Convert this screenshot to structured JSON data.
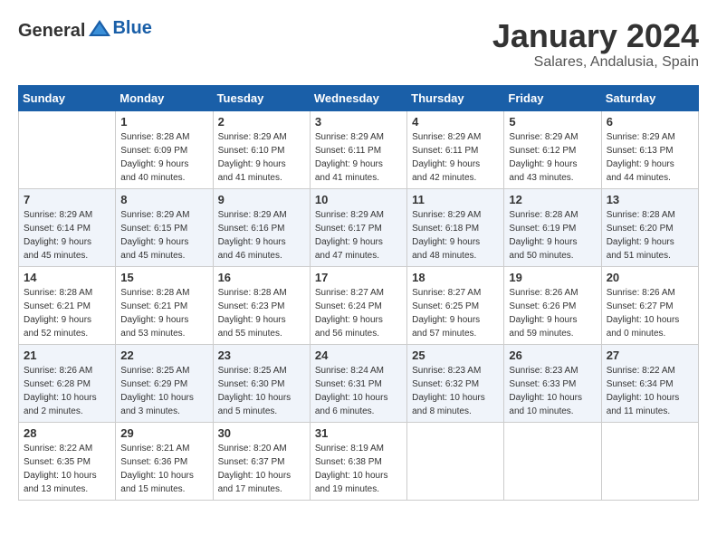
{
  "logo": {
    "general": "General",
    "blue": "Blue"
  },
  "header": {
    "month": "January 2024",
    "location": "Salares, Andalusia, Spain"
  },
  "columns": [
    "Sunday",
    "Monday",
    "Tuesday",
    "Wednesday",
    "Thursday",
    "Friday",
    "Saturday"
  ],
  "weeks": [
    [
      {
        "day": "",
        "info": ""
      },
      {
        "day": "1",
        "info": "Sunrise: 8:28 AM\nSunset: 6:09 PM\nDaylight: 9 hours\nand 40 minutes."
      },
      {
        "day": "2",
        "info": "Sunrise: 8:29 AM\nSunset: 6:10 PM\nDaylight: 9 hours\nand 41 minutes."
      },
      {
        "day": "3",
        "info": "Sunrise: 8:29 AM\nSunset: 6:11 PM\nDaylight: 9 hours\nand 41 minutes."
      },
      {
        "day": "4",
        "info": "Sunrise: 8:29 AM\nSunset: 6:11 PM\nDaylight: 9 hours\nand 42 minutes."
      },
      {
        "day": "5",
        "info": "Sunrise: 8:29 AM\nSunset: 6:12 PM\nDaylight: 9 hours\nand 43 minutes."
      },
      {
        "day": "6",
        "info": "Sunrise: 8:29 AM\nSunset: 6:13 PM\nDaylight: 9 hours\nand 44 minutes."
      }
    ],
    [
      {
        "day": "7",
        "info": "Sunrise: 8:29 AM\nSunset: 6:14 PM\nDaylight: 9 hours\nand 45 minutes."
      },
      {
        "day": "8",
        "info": "Sunrise: 8:29 AM\nSunset: 6:15 PM\nDaylight: 9 hours\nand 45 minutes."
      },
      {
        "day": "9",
        "info": "Sunrise: 8:29 AM\nSunset: 6:16 PM\nDaylight: 9 hours\nand 46 minutes."
      },
      {
        "day": "10",
        "info": "Sunrise: 8:29 AM\nSunset: 6:17 PM\nDaylight: 9 hours\nand 47 minutes."
      },
      {
        "day": "11",
        "info": "Sunrise: 8:29 AM\nSunset: 6:18 PM\nDaylight: 9 hours\nand 48 minutes."
      },
      {
        "day": "12",
        "info": "Sunrise: 8:28 AM\nSunset: 6:19 PM\nDaylight: 9 hours\nand 50 minutes."
      },
      {
        "day": "13",
        "info": "Sunrise: 8:28 AM\nSunset: 6:20 PM\nDaylight: 9 hours\nand 51 minutes."
      }
    ],
    [
      {
        "day": "14",
        "info": "Sunrise: 8:28 AM\nSunset: 6:21 PM\nDaylight: 9 hours\nand 52 minutes."
      },
      {
        "day": "15",
        "info": "Sunrise: 8:28 AM\nSunset: 6:21 PM\nDaylight: 9 hours\nand 53 minutes."
      },
      {
        "day": "16",
        "info": "Sunrise: 8:28 AM\nSunset: 6:23 PM\nDaylight: 9 hours\nand 55 minutes."
      },
      {
        "day": "17",
        "info": "Sunrise: 8:27 AM\nSunset: 6:24 PM\nDaylight: 9 hours\nand 56 minutes."
      },
      {
        "day": "18",
        "info": "Sunrise: 8:27 AM\nSunset: 6:25 PM\nDaylight: 9 hours\nand 57 minutes."
      },
      {
        "day": "19",
        "info": "Sunrise: 8:26 AM\nSunset: 6:26 PM\nDaylight: 9 hours\nand 59 minutes."
      },
      {
        "day": "20",
        "info": "Sunrise: 8:26 AM\nSunset: 6:27 PM\nDaylight: 10 hours\nand 0 minutes."
      }
    ],
    [
      {
        "day": "21",
        "info": "Sunrise: 8:26 AM\nSunset: 6:28 PM\nDaylight: 10 hours\nand 2 minutes."
      },
      {
        "day": "22",
        "info": "Sunrise: 8:25 AM\nSunset: 6:29 PM\nDaylight: 10 hours\nand 3 minutes."
      },
      {
        "day": "23",
        "info": "Sunrise: 8:25 AM\nSunset: 6:30 PM\nDaylight: 10 hours\nand 5 minutes."
      },
      {
        "day": "24",
        "info": "Sunrise: 8:24 AM\nSunset: 6:31 PM\nDaylight: 10 hours\nand 6 minutes."
      },
      {
        "day": "25",
        "info": "Sunrise: 8:23 AM\nSunset: 6:32 PM\nDaylight: 10 hours\nand 8 minutes."
      },
      {
        "day": "26",
        "info": "Sunrise: 8:23 AM\nSunset: 6:33 PM\nDaylight: 10 hours\nand 10 minutes."
      },
      {
        "day": "27",
        "info": "Sunrise: 8:22 AM\nSunset: 6:34 PM\nDaylight: 10 hours\nand 11 minutes."
      }
    ],
    [
      {
        "day": "28",
        "info": "Sunrise: 8:22 AM\nSunset: 6:35 PM\nDaylight: 10 hours\nand 13 minutes."
      },
      {
        "day": "29",
        "info": "Sunrise: 8:21 AM\nSunset: 6:36 PM\nDaylight: 10 hours\nand 15 minutes."
      },
      {
        "day": "30",
        "info": "Sunrise: 8:20 AM\nSunset: 6:37 PM\nDaylight: 10 hours\nand 17 minutes."
      },
      {
        "day": "31",
        "info": "Sunrise: 8:19 AM\nSunset: 6:38 PM\nDaylight: 10 hours\nand 19 minutes."
      },
      {
        "day": "",
        "info": ""
      },
      {
        "day": "",
        "info": ""
      },
      {
        "day": "",
        "info": ""
      }
    ]
  ]
}
